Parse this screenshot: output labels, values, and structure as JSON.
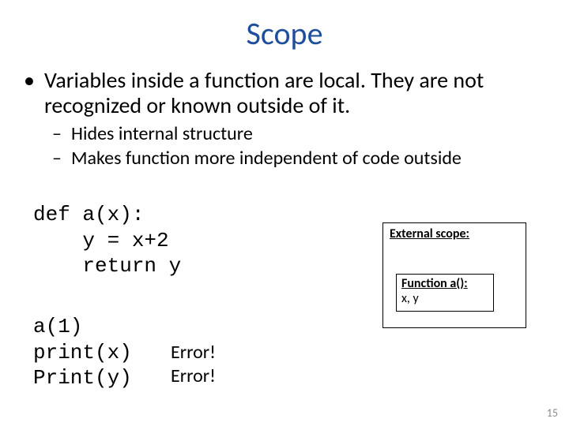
{
  "title": "Scope",
  "bullets": {
    "l1": "Variables inside a function are local. They are not recognized or known outside of it.",
    "l2a": "Hides internal structure",
    "l2b": "Makes function more independent of code outside"
  },
  "code": {
    "def_block": "def a(x):\n    y = x+2\n    return y",
    "call_block": "a(1)\nprint(x)\nPrint(y)"
  },
  "errors": {
    "e1": "Error!",
    "e2": "Error!"
  },
  "scope": {
    "outer_label": "External scope:",
    "inner_label": "Function a():",
    "inner_vars": "x, y"
  },
  "page_number": "15"
}
